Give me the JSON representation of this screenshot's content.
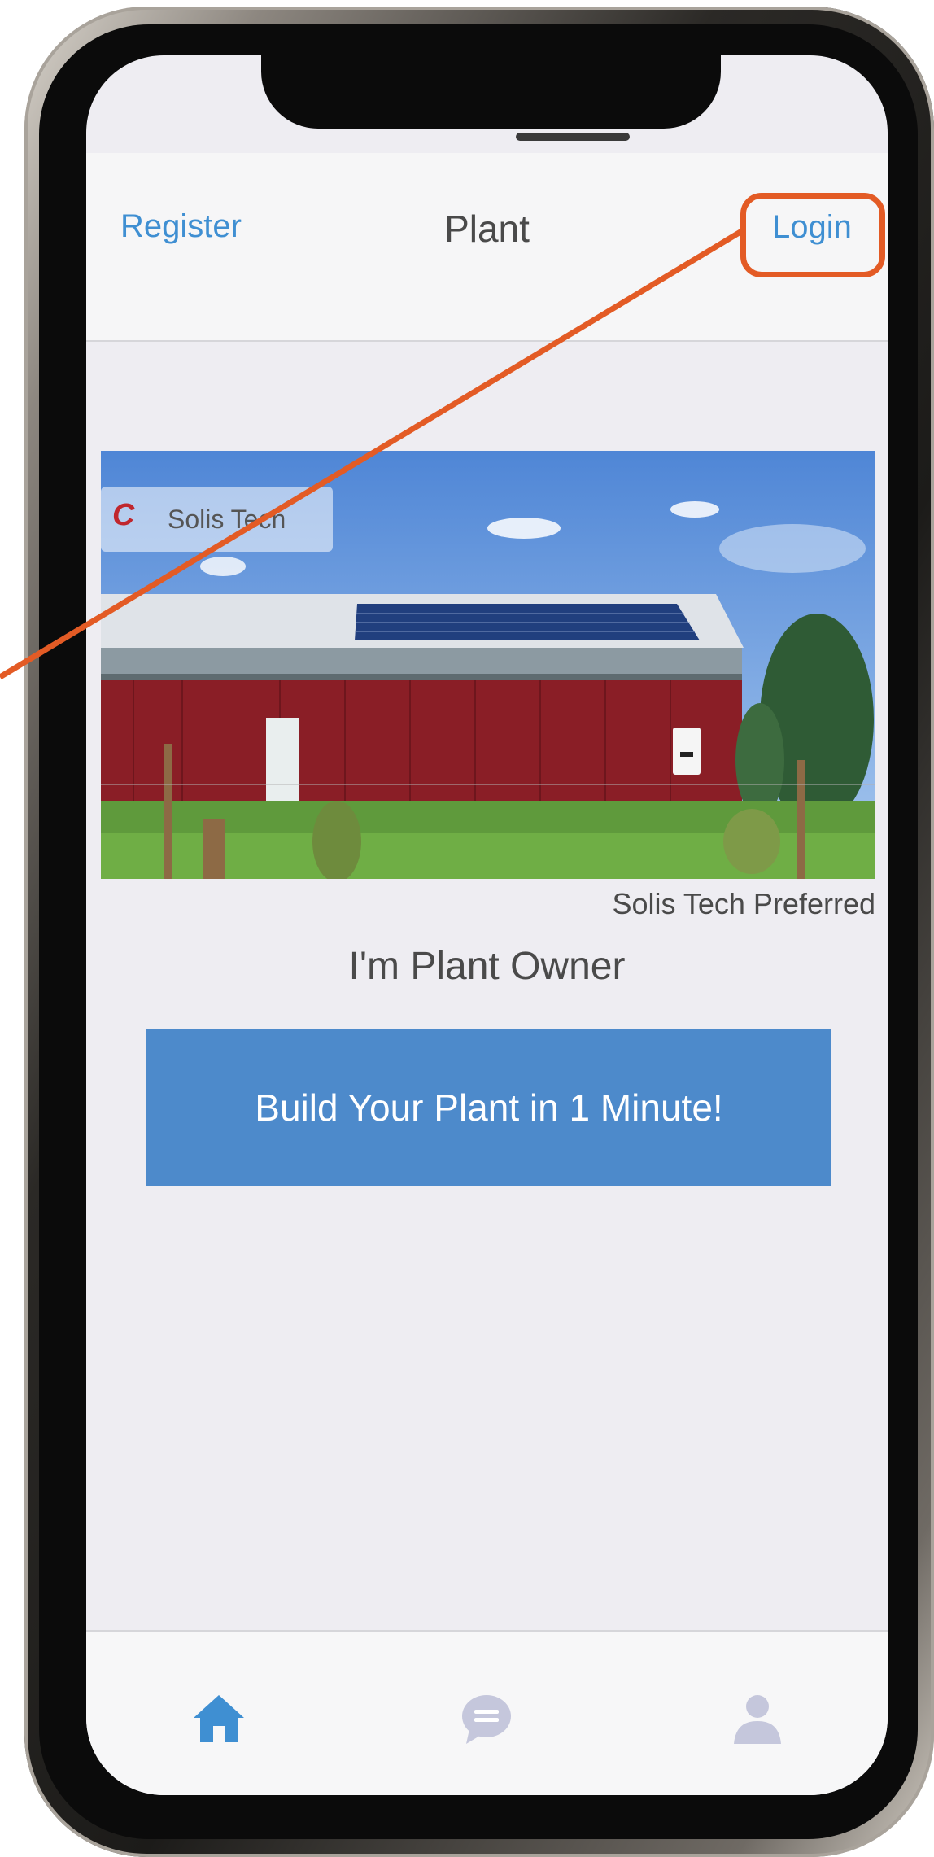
{
  "header": {
    "register_label": "Register",
    "title": "Plant",
    "login_label": "Login"
  },
  "banner": {
    "logo_text": "Solis Tech",
    "caption": "Solis Tech Preferred"
  },
  "owner_label": "I'm Plant Owner",
  "cta_label": "Build Your Plant in 1 Minute!",
  "tabbar": {
    "items": [
      {
        "icon": "home-icon",
        "active": true
      },
      {
        "icon": "chat-bubble-icon",
        "active": false
      },
      {
        "icon": "user-icon",
        "active": false
      }
    ]
  },
  "colors": {
    "accent": "#3f8fd2",
    "button": "#4d8acb",
    "callout": "#e35b25",
    "inactive_icon": "#c5c7dc"
  }
}
